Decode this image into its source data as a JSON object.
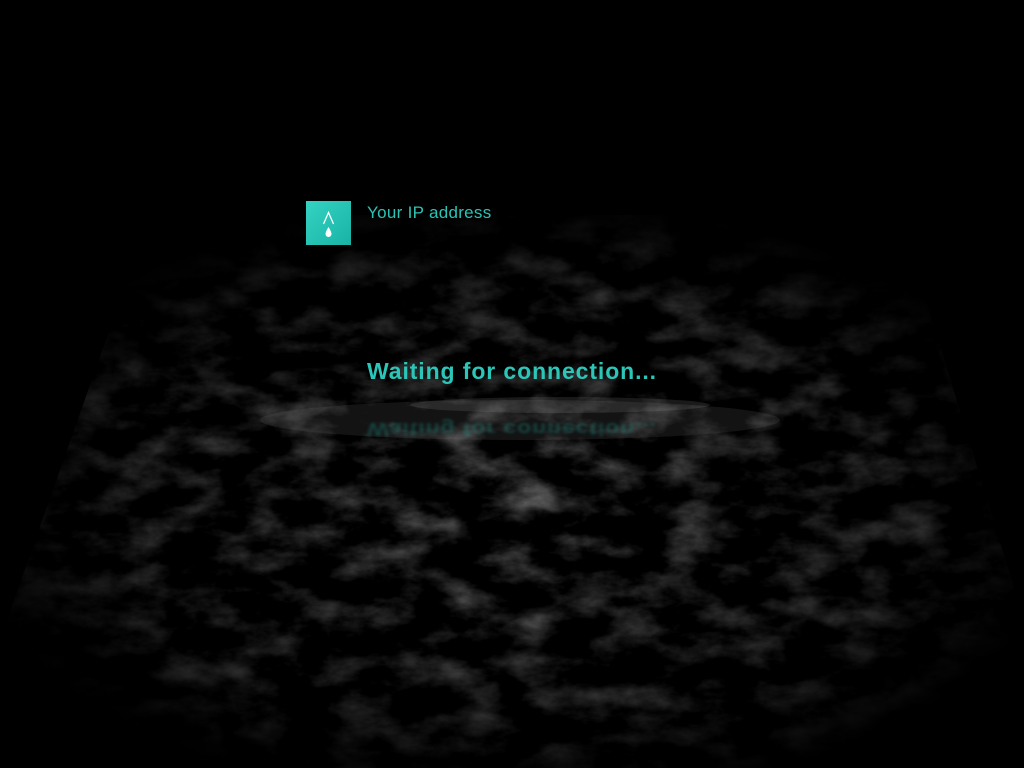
{
  "app": {
    "logo_icon": "drop-logo-icon",
    "accent_color": "#2cc6b8"
  },
  "header": {
    "ip_label": "Your IP address"
  },
  "status": {
    "message": "Waiting for connection..."
  }
}
